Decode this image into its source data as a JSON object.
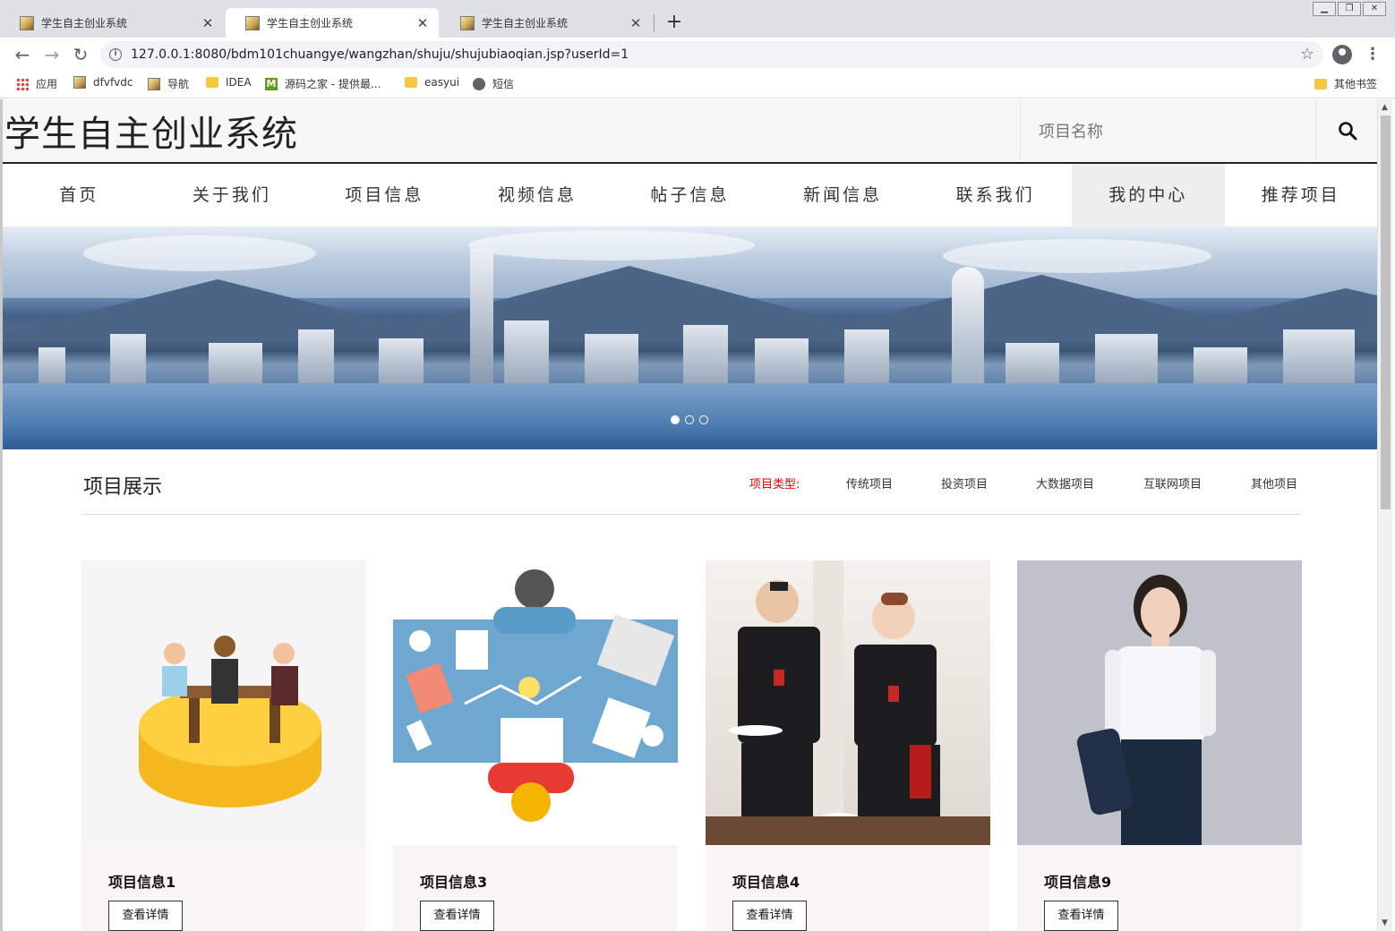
{
  "browser": {
    "tabs": [
      {
        "title": "学生自主创业系统",
        "active": false
      },
      {
        "title": "学生自主创业系统",
        "active": true
      },
      {
        "title": "学生自主创业系统",
        "active": false
      }
    ],
    "new_tab": "+",
    "close": "✕",
    "url": "127.0.0.1:8080/bdm101chuangye/wangzhan/shuju/shujubiaoqian.jsp?userId=1",
    "bookmarks": [
      {
        "label": "应用",
        "icon": "apps-icon"
      },
      {
        "label": "dfvfvdc",
        "icon": "page-icon"
      },
      {
        "label": "导航",
        "icon": "page-icon"
      },
      {
        "label": "IDEA",
        "icon": "folder-icon"
      },
      {
        "label": "源码之家 - 提供最...",
        "icon": "m-site-icon"
      },
      {
        "label": "easyui",
        "icon": "folder-icon"
      },
      {
        "label": "短信",
        "icon": "globe-icon"
      }
    ],
    "other_bookmarks": "其他书签"
  },
  "site": {
    "title": "学生自主创业系统",
    "search_placeholder": "项目名称",
    "nav": [
      {
        "label": "首页",
        "active": false
      },
      {
        "label": "关于我们",
        "active": false
      },
      {
        "label": "项目信息",
        "active": false
      },
      {
        "label": "视频信息",
        "active": false
      },
      {
        "label": "帖子信息",
        "active": false
      },
      {
        "label": "新闻信息",
        "active": false
      },
      {
        "label": "联系我们",
        "active": false
      },
      {
        "label": "我的中心",
        "active": true
      },
      {
        "label": "推荐项目",
        "active": false
      }
    ],
    "banner": {
      "slides": 3,
      "current": 1
    },
    "section": {
      "title": "项目展示",
      "type_label": "项目类型:",
      "types": [
        "传统项目",
        "投资项目",
        "大数据项目",
        "互联网项目",
        "其他项目"
      ]
    },
    "projects": [
      {
        "title": "项目信息1",
        "button": "查看详情"
      },
      {
        "title": "项目信息3",
        "button": "查看详情"
      },
      {
        "title": "项目信息4",
        "button": "查看详情"
      },
      {
        "title": "项目信息9",
        "button": "查看详情"
      }
    ]
  },
  "colors": {
    "accent_red": "#e00000",
    "nav_active_bg": "#eeeeee"
  }
}
